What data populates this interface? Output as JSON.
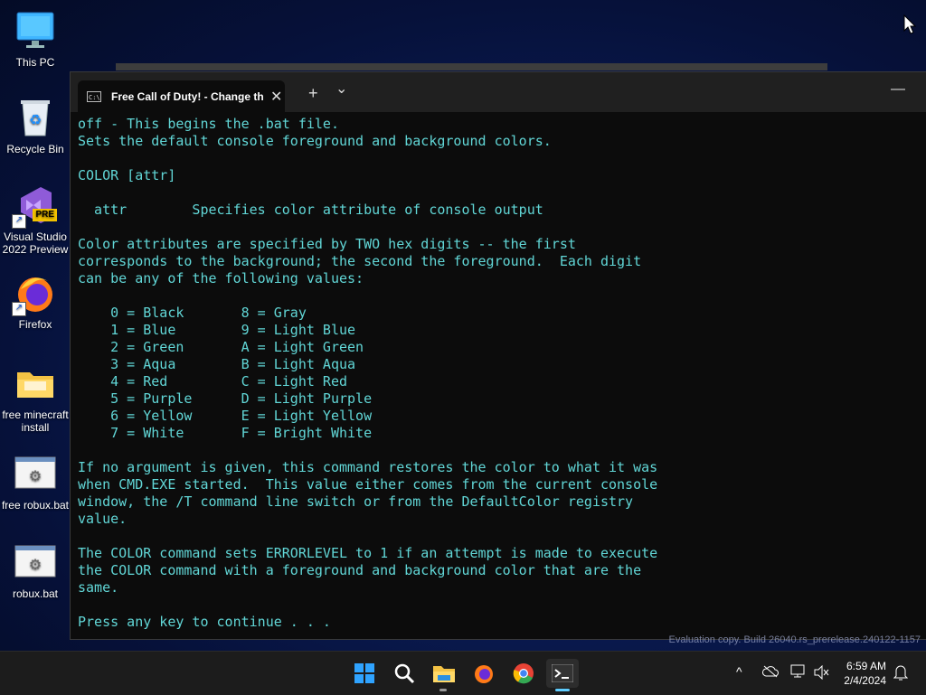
{
  "desktop": {
    "icons": [
      {
        "label": "This PC",
        "icon": "monitor-icon"
      },
      {
        "label": "Recycle Bin",
        "icon": "recycle-bin-icon"
      },
      {
        "label": "Visual Studio 2022 Preview",
        "icon": "visual-studio-icon",
        "badge": "PRE"
      },
      {
        "label": "Firefox",
        "icon": "firefox-icon"
      },
      {
        "label": "free minecraft install",
        "icon": "folder-icon"
      },
      {
        "label": "free robux.bat",
        "icon": "batch-file-icon"
      },
      {
        "label": "robux.bat",
        "icon": "batch-file-icon"
      }
    ]
  },
  "terminal": {
    "tab_title": "Free Call of Duty! - Change th",
    "tab_icon_text": "C:\\",
    "close_glyph": "✕",
    "new_tab_glyph": "+",
    "dropdown_glyph": "⌄",
    "minimize_glyph": "—",
    "text_color": "#61d6d6",
    "lines": [
      "off - This begins the .bat file.",
      "Sets the default console foreground and background colors.",
      "",
      "COLOR [attr]",
      "",
      "  attr        Specifies color attribute of console output",
      "",
      "Color attributes are specified by TWO hex digits -- the first",
      "corresponds to the background; the second the foreground.  Each digit",
      "can be any of the following values:",
      "",
      "    0 = Black       8 = Gray",
      "    1 = Blue        9 = Light Blue",
      "    2 = Green       A = Light Green",
      "    3 = Aqua        B = Light Aqua",
      "    4 = Red         C = Light Red",
      "    5 = Purple      D = Light Purple",
      "    6 = Yellow      E = Light Yellow",
      "    7 = White       F = Bright White",
      "",
      "If no argument is given, this command restores the color to what it was",
      "when CMD.EXE started.  This value either comes from the current console",
      "window, the /T command line switch or from the DefaultColor registry",
      "value.",
      "",
      "The COLOR command sets ERRORLEVEL to 1 if an attempt is made to execute",
      "the COLOR command with a foreground and background color that are the",
      "same.",
      "",
      "Press any key to continue . . ."
    ]
  },
  "watermark": "Evaluation copy. Build 26040.rs_prerelease.240122-1157",
  "taskbar": {
    "apps": [
      "windows-start-icon",
      "search-icon",
      "file-explorer-icon",
      "firefox-icon",
      "chrome-icon",
      "terminal-icon"
    ],
    "time": "6:59 AM",
    "date": "2/4/2024",
    "tray_chevron": "^"
  }
}
